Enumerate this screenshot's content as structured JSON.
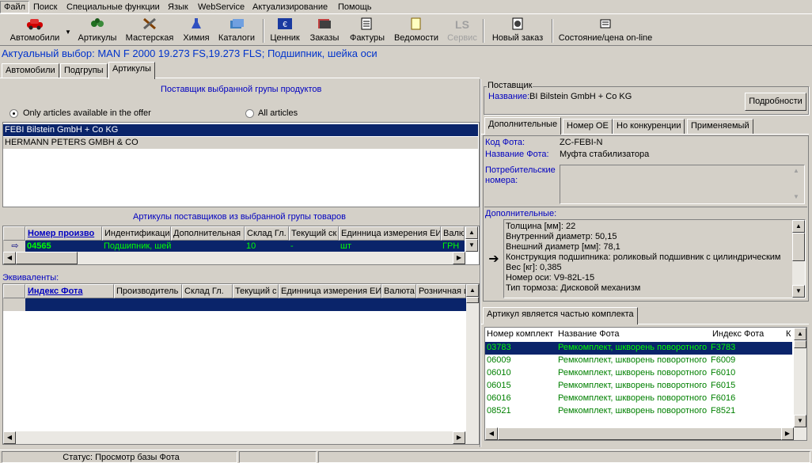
{
  "menu": [
    "Файл",
    "Поиск",
    "Специальные функции",
    "Язык",
    "WebService",
    "Актуализирование",
    "Помощь"
  ],
  "toolbar": {
    "cars": "Автомобили",
    "articles": "Артикулы",
    "workshop": "Мастерская",
    "chemistry": "Химия",
    "catalogs": "Каталоги",
    "pricelist": "Ценник",
    "orders": "Заказы",
    "invoices": "Фактуры",
    "statements": "Ведомости",
    "service": "Сервис",
    "new_order": "Новый заказ",
    "state_price": "Состояние/цена on-line"
  },
  "selection": "Актуальный выбор: MAN F 2000 19.273 FS,19.273 FLS; Подшипник, шейка оси",
  "left_tabs": [
    "Автомобили",
    "Подгрупы",
    "Артикулы"
  ],
  "supplier_panel": {
    "title": "Поставщик выбранной групы продуктов",
    "radio_available": "Only articles available in the offer",
    "radio_all": "All articles",
    "suppliers": [
      "FEBI Bilstein GmbH + Co KG",
      "HERMANN PETERS GMBH & CO"
    ]
  },
  "articles_panel": {
    "title": "Артикулы поставщиков из выбранной групы товаров",
    "columns": [
      "Номер произво",
      "Индентификаци",
      "Дополнительная",
      "Склад Гл.",
      "Текущий ск",
      "Единница измерения ЕИ",
      "Валют"
    ],
    "row": [
      "04565",
      "Подшипник, шей",
      "",
      "10",
      "-",
      "шт",
      "ГРН"
    ]
  },
  "equivalents_panel": {
    "title": "Эквиваленты:",
    "columns": [
      "Индекс Фота",
      "Производитель",
      "Склад Гл.",
      "Текущий с",
      "Единница измерения ЕИ",
      "Валюта",
      "Розничная ц"
    ]
  },
  "supplier_box": {
    "legend": "Поставщик",
    "name_label": "Название:",
    "name_value": "BI Bilstein GmbH + Co KG",
    "details_button": "Подробности"
  },
  "right_tabs": [
    "Дополнительные",
    "Номер OE",
    "Но конкуренции",
    "Применяемый"
  ],
  "details": {
    "code_label": "Код Фота:",
    "code_value": "ZC-FEBI-N",
    "name_label": "Название Фота:",
    "name_value": "Муфта стабилизатора",
    "consumer_label_1": "Потребительские",
    "consumer_label_2": "номера:",
    "additional_label": "Дополнительные:",
    "additional": [
      "Толщина [мм]: 22",
      "Внутренний диаметр: 50,15",
      "Внешний диаметр [мм]: 78,1",
      "Конструкция подшипника: роликовый подшивник с цилиндрическим",
      "Вес [кг]: 0,385",
      "Номер оси: V9-82L-15",
      "Тип тормоза: Дисковой механизм"
    ]
  },
  "kit_tab": "Артикул является частью комплекта",
  "kit_panel": {
    "columns": [
      "Номер комплект",
      "Название Фота",
      "Индекс Фота",
      "К"
    ],
    "rows": [
      [
        "03783",
        "Ремкомплект, шкворень поворотного",
        "F3783"
      ],
      [
        "06009",
        "Ремкомплект, шкворень поворотного",
        "F6009"
      ],
      [
        "06010",
        "Ремкомплект, шкворень поворотного",
        "F6010"
      ],
      [
        "06015",
        "Ремкомплект, шкворень поворотного",
        "F6015"
      ],
      [
        "06016",
        "Ремкомплект, шкворень поворотного",
        "F6016"
      ],
      [
        "08521",
        "Ремкомплект, шкворень поворотного",
        "F8521"
      ]
    ]
  },
  "status": {
    "text": "Статус: Просмотр базы Фота"
  },
  "colors": {
    "selection_bg": "#0a246a",
    "selection_text": "#ffffff",
    "link_blue": "#0000c0",
    "kit_green": "#008000",
    "article_green": "#00ff00"
  }
}
